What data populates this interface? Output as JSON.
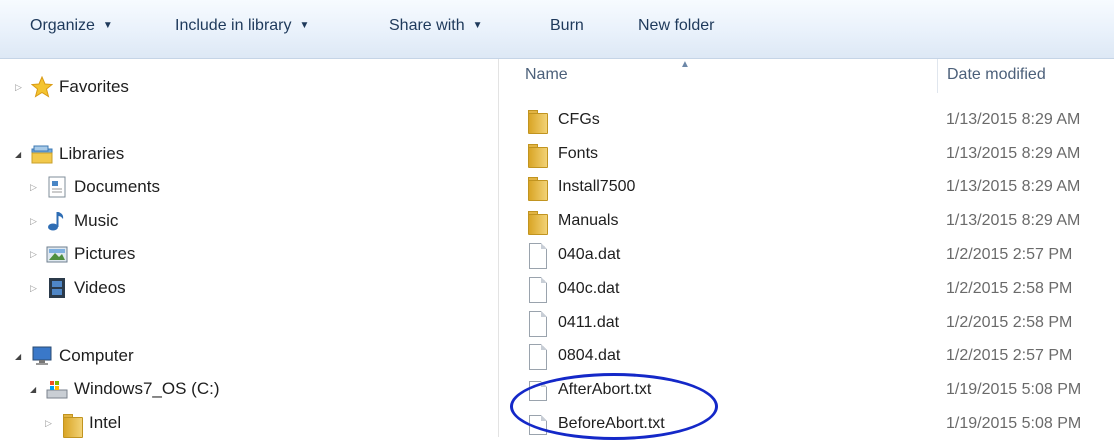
{
  "toolbar": {
    "organize": "Organize",
    "include_in_library": "Include in library",
    "share_with": "Share with",
    "burn": "Burn",
    "new_folder": "New folder",
    "dropdown_icon": "chevron-down-icon"
  },
  "nav": {
    "favorites": "Favorites",
    "libraries": "Libraries",
    "documents": "Documents",
    "music": "Music",
    "pictures": "Pictures",
    "videos": "Videos",
    "computer": "Computer",
    "drive": "Windows7_OS (C:)",
    "intel": "Intel"
  },
  "columns": {
    "name": "Name",
    "date_modified": "Date modified"
  },
  "files": [
    {
      "name": "CFGs",
      "date": "1/13/2015 8:29 AM",
      "type": "folder"
    },
    {
      "name": "Fonts",
      "date": "1/13/2015 8:29 AM",
      "type": "folder"
    },
    {
      "name": "Install7500",
      "date": "1/13/2015 8:29 AM",
      "type": "folder"
    },
    {
      "name": "Manuals",
      "date": "1/13/2015 8:29 AM",
      "type": "folder"
    },
    {
      "name": "040a.dat",
      "date": "1/2/2015 2:57 PM",
      "type": "file"
    },
    {
      "name": "040c.dat",
      "date": "1/2/2015 2:58 PM",
      "type": "file"
    },
    {
      "name": "0411.dat",
      "date": "1/2/2015 2:58 PM",
      "type": "file"
    },
    {
      "name": "0804.dat",
      "date": "1/2/2015 2:57 PM",
      "type": "file"
    },
    {
      "name": "AfterAbort.txt",
      "date": "1/19/2015 5:08 PM",
      "type": "file"
    },
    {
      "name": "BeforeAbort.txt",
      "date": "1/19/2015 5:08 PM",
      "type": "file"
    }
  ],
  "colors": {
    "toolbar_text": "#1e395b",
    "folder": "#e2b444",
    "annotation": "#1428c8"
  }
}
